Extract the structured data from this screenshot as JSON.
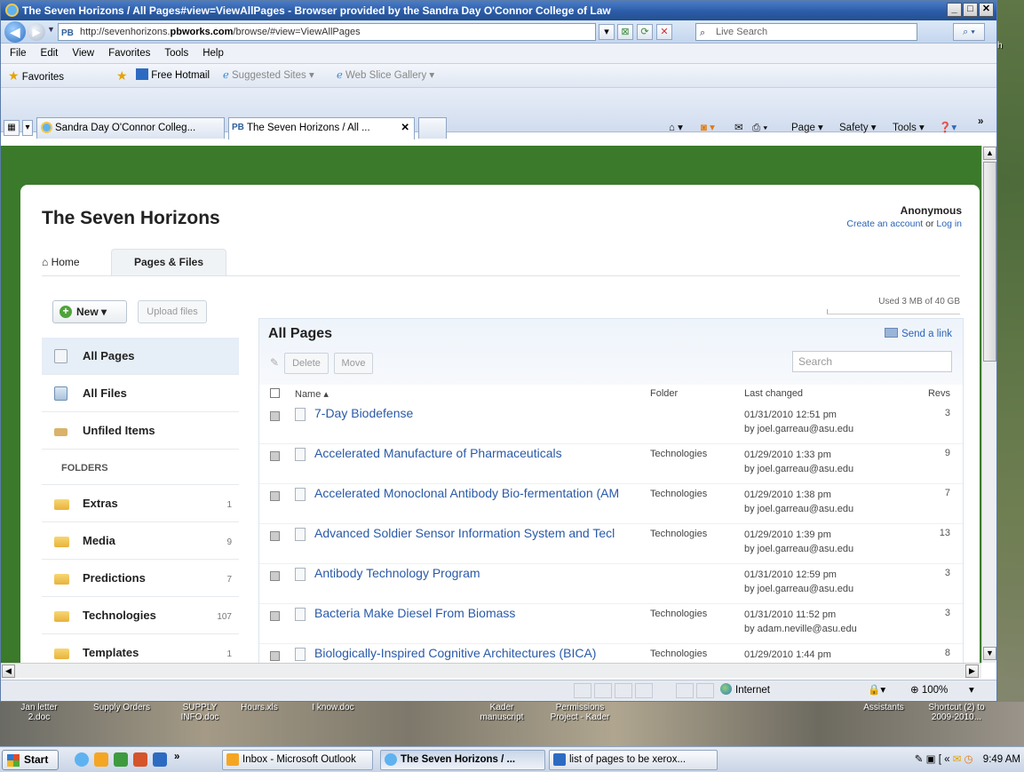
{
  "browser": {
    "title": "The Seven Horizons / All Pages#view=ViewAllPages - Browser provided by the Sandra Day O'Connor College of Law",
    "url_prefix": "http://sevenhorizons.",
    "url_bold": "pbworks.com",
    "url_suffix": "/browse/#view=ViewAllPages",
    "url_badge": "PB",
    "search_placeholder": "Live Search",
    "menus": [
      "File",
      "Edit",
      "View",
      "Favorites",
      "Tools",
      "Help"
    ],
    "favorites_label": "Favorites",
    "fav_links": [
      "Free Hotmail",
      "Suggested Sites ▾",
      "Web Slice Gallery ▾"
    ],
    "tabs": [
      {
        "label": "Sandra Day O'Connor Colleg...",
        "active": false
      },
      {
        "label": "The Seven Horizons / All ...",
        "active": true
      }
    ],
    "commands": [
      "Page ▾",
      "Safety ▾",
      "Tools ▾"
    ],
    "status_zone": "Internet",
    "zoom": "⊕ 100%"
  },
  "site": {
    "title": "The Seven Horizons",
    "user": "Anonymous",
    "create_account": "Create an account",
    "or_text": " or ",
    "login": "Log in",
    "nav_home": "⌂ Home",
    "nav_pages": "Pages & Files",
    "usage": "Used 3 MB of 40 GB",
    "usage_fraction": 0.0001,
    "new_label": "New ▾",
    "upload_label": "Upload files"
  },
  "sidebar": {
    "items": [
      {
        "label": "All Pages",
        "active": true
      },
      {
        "label": "All Files",
        "active": false
      },
      {
        "label": "Unfiled Items",
        "active": false
      }
    ],
    "folders_header": "FOLDERS",
    "folders": [
      {
        "label": "Extras",
        "count": "1"
      },
      {
        "label": "Media",
        "count": "9"
      },
      {
        "label": "Predictions",
        "count": "7"
      },
      {
        "label": "Technologies",
        "count": "107"
      },
      {
        "label": "Templates",
        "count": "1"
      }
    ]
  },
  "content": {
    "title": "All Pages",
    "send_link": "Send a link",
    "delete_label": "Delete",
    "move_label": "Move",
    "search_placeholder": "Search",
    "columns": {
      "name": "Name ▴",
      "folder": "Folder",
      "changed": "Last changed",
      "revs": "Revs"
    },
    "rows": [
      {
        "name": "7-Day Biodefense",
        "folder": "",
        "date": "01/31/2010 12:51 pm",
        "by": "by joel.garreau@asu.edu",
        "revs": "3"
      },
      {
        "name": "Accelerated Manufacture of Pharmaceuticals",
        "folder": "Technologies",
        "date": "01/29/2010 1:33 pm",
        "by": "by joel.garreau@asu.edu",
        "revs": "9"
      },
      {
        "name": "Accelerated Monoclonal Antibody Bio-fermentation (AM",
        "folder": "Technologies",
        "date": "01/29/2010 1:38 pm",
        "by": "by joel.garreau@asu.edu",
        "revs": "7"
      },
      {
        "name": "Advanced Soldier Sensor Information System and Tecl",
        "folder": "Technologies",
        "date": "01/29/2010 1:39 pm",
        "by": "by joel.garreau@asu.edu",
        "revs": "13"
      },
      {
        "name": "Antibody Technology Program",
        "folder": "",
        "date": "01/31/2010 12:59 pm",
        "by": "by joel.garreau@asu.edu",
        "revs": "3"
      },
      {
        "name": "Bacteria Make Diesel From Biomass",
        "folder": "Technologies",
        "date": "01/31/2010 11:52 pm",
        "by": "by adam.neville@asu.edu",
        "revs": "3"
      },
      {
        "name": "Biologically-Inspired Cognitive Architectures (BICA)",
        "folder": "Technologies",
        "date": "01/29/2010 1:44 pm",
        "by": "",
        "revs": "8"
      }
    ]
  },
  "desktop": {
    "icons": [
      {
        "label": "Jan letter\n2.doc"
      },
      {
        "label": "Supply Orders"
      },
      {
        "label": "SUPPLY\nINFO.doc"
      },
      {
        "label": "Hours.xls"
      },
      {
        "label": "I know.doc"
      },
      {
        "label": "Kader\nmanuscript"
      },
      {
        "label": "Permissions\nProject - Kader"
      },
      {
        "label": "Assistants"
      },
      {
        "label": "Shortcut (2) to\n2009-2010..."
      }
    ]
  },
  "taskbar": {
    "start": "Start",
    "tasks": [
      {
        "label": "Inbox - Microsoft Outlook",
        "active": false
      },
      {
        "label": "The Seven Horizons / ...",
        "active": true
      },
      {
        "label": "list of pages to be xerox...",
        "active": false
      }
    ],
    "clock": "9:49 AM"
  }
}
